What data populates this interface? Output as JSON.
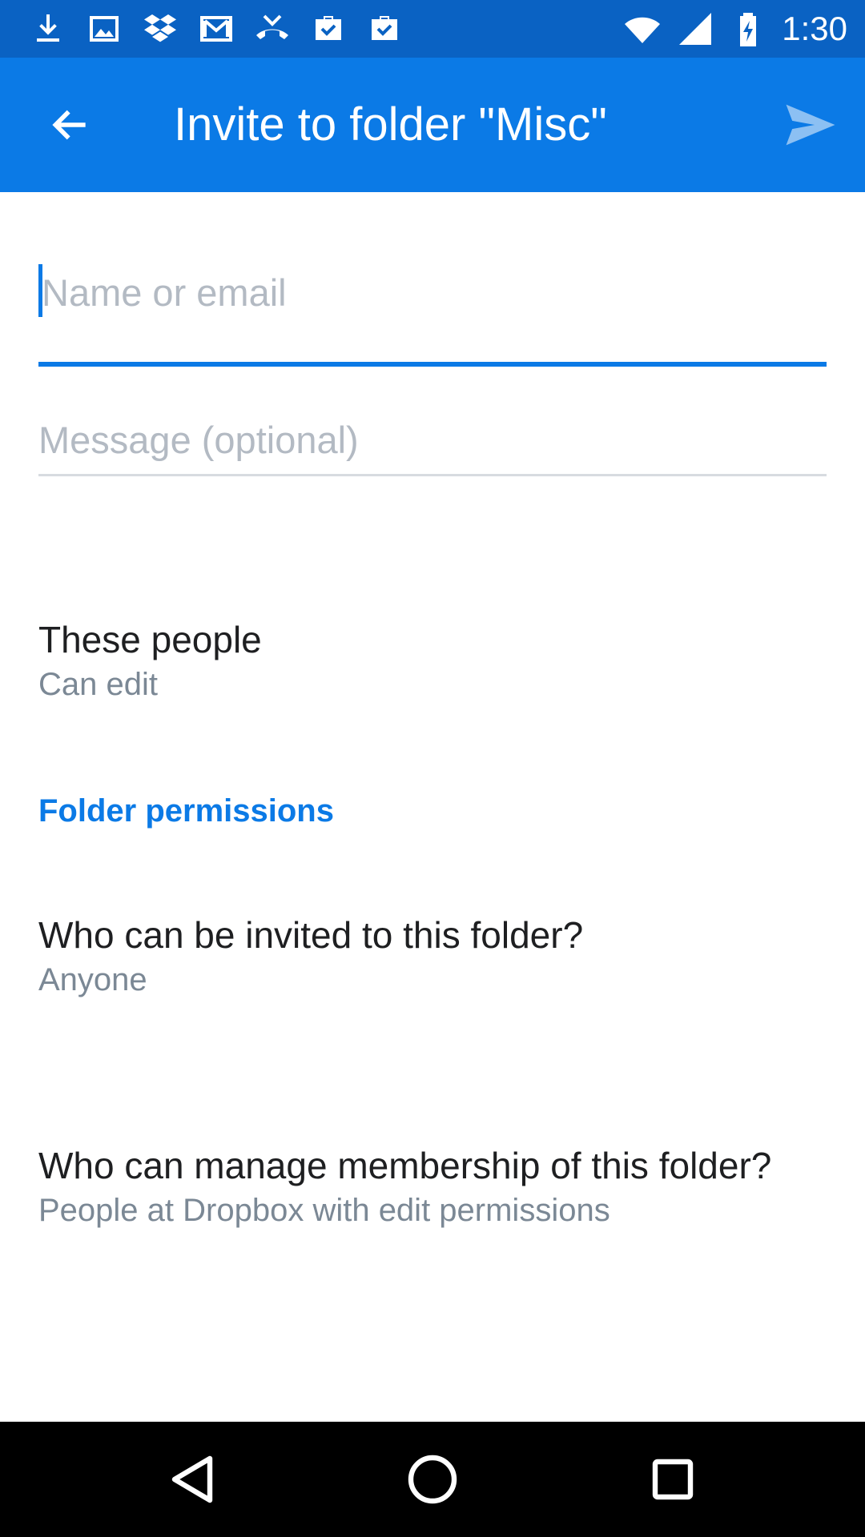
{
  "status_bar": {
    "time": "1:30",
    "left_icons": [
      "download-icon",
      "image-icon",
      "dropbox-icon",
      "gmail-icon",
      "missed-call-icon",
      "briefcase-check-icon",
      "briefcase-check-icon"
    ],
    "right_icons": [
      "wifi-icon",
      "cell-signal-icon",
      "battery-charging-icon"
    ]
  },
  "app_bar": {
    "title": "Invite to folder \"Misc\"",
    "back_icon": "arrow-back-icon",
    "send_icon": "send-icon",
    "color": "#0b7ae6"
  },
  "form": {
    "name_placeholder": "Name or email",
    "name_value": "",
    "message_placeholder": "Message (optional)",
    "message_value": ""
  },
  "permissions": {
    "these_people": {
      "title": "These people",
      "subtitle": "Can edit"
    },
    "section_header": "Folder permissions",
    "who_invite": {
      "title": "Who can be invited to this folder?",
      "subtitle": "Anyone"
    },
    "who_manage": {
      "title": "Who can manage membership of this folder?",
      "subtitle": "People at Dropbox with edit permissions"
    }
  },
  "nav_bar": {
    "back": "nav-back-icon",
    "home": "nav-home-icon",
    "recents": "nav-recents-icon"
  }
}
